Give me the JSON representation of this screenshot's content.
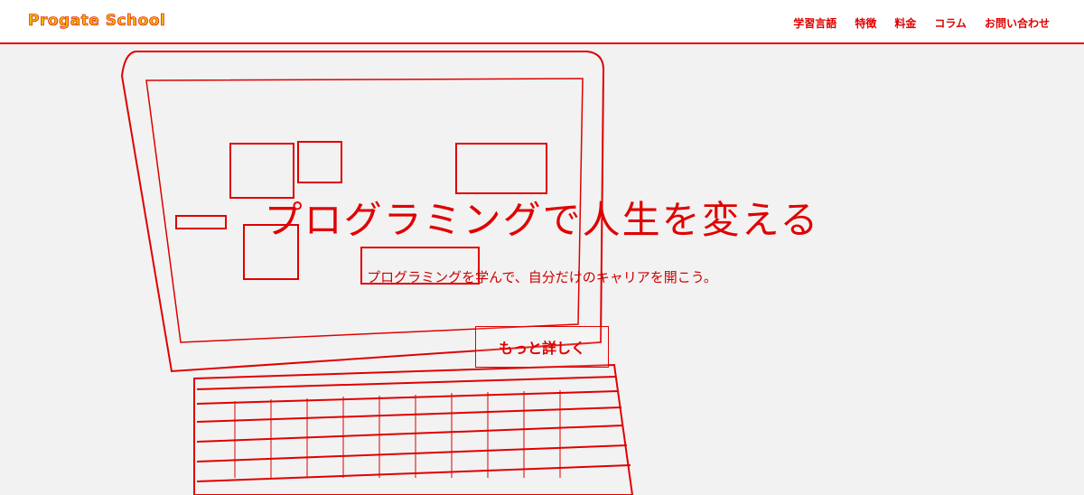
{
  "header": {
    "logo": "Progate School",
    "nav": [
      "学習言語",
      "特徴",
      "料金",
      "コラム",
      "お問い合わせ"
    ]
  },
  "hero": {
    "headline": "プログラミングで人生を変える",
    "subline": "プログラミングを学んで、自分だけのキャリアを開こう。",
    "cta": "もっと詳しく"
  },
  "colors": {
    "accent": "#e00000",
    "logo_fill": "#f0b400",
    "background": "#f2f2f2"
  }
}
